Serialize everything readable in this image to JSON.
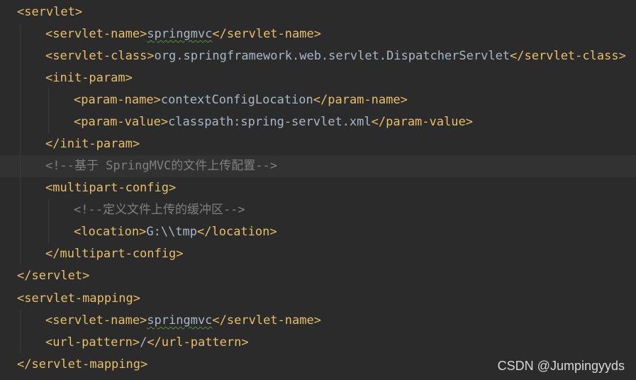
{
  "editor": {
    "lines": {
      "l1": {
        "open": "<servlet>"
      },
      "l2": {
        "open": "<servlet-name>",
        "value": "springmvc",
        "close": "</servlet-name>"
      },
      "l3": {
        "open": "<servlet-class>",
        "value": "org.springframework.web.servlet.DispatcherServlet",
        "close": "</servlet-class>"
      },
      "l4": {
        "open": "<init-param>"
      },
      "l5": {
        "open": "<param-name>",
        "value": "contextConfigLocation",
        "close": "</param-name>"
      },
      "l6": {
        "open": "<param-value>",
        "value": "classpath:spring-servlet.xml",
        "close": "</param-value>"
      },
      "l7": {
        "close": "</init-param>"
      },
      "l8": {
        "comment": "<!--基于 SpringMVC的文件上传配置-->"
      },
      "l9": {
        "open": "<multipart-config>"
      },
      "l10": {
        "comment": "<!--定义文件上传的缓冲区-->"
      },
      "l11": {
        "open": "<location>",
        "value": "G:\\\\tmp",
        "close": "</location>"
      },
      "l12": {
        "close": "</multipart-config>"
      },
      "l13": {
        "close": "</servlet>"
      },
      "l14": {
        "open": "<servlet-mapping>"
      },
      "l15": {
        "open": "<servlet-name>",
        "value": "springmvc",
        "close": "</servlet-name>"
      },
      "l16": {
        "open": "<url-pattern>",
        "value": "/",
        "close": "</url-pattern>"
      },
      "l17": {
        "close": "</servlet-mapping>"
      }
    }
  },
  "watermark": "CSDN @Jumpingyyds",
  "colors": {
    "background": "#2b2b2b",
    "current_line": "#323232",
    "tag": "#e8bf6a",
    "text": "#a9b7c6",
    "comment": "#808080",
    "typo_underline": "#5e8f3c"
  }
}
